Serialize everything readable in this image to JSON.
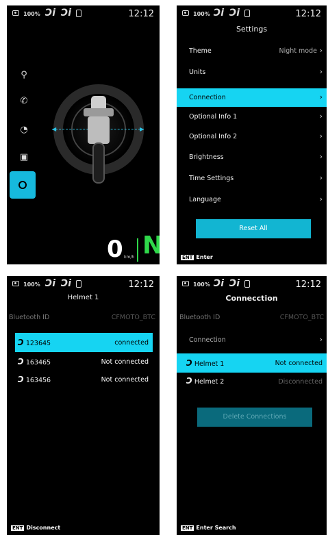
{
  "status": {
    "battery": "100%",
    "time": "12:12",
    "helmet_glyph": "Ɔi"
  },
  "dashboard": {
    "speed": "0",
    "speed_unit": "km/h",
    "gear": "N",
    "side_icons": [
      "motorcycle-icon",
      "phone-icon",
      "gauge-icon",
      "screen-icon",
      "gear-icon"
    ]
  },
  "settings": {
    "title": "Settings",
    "items": [
      {
        "label": "Theme",
        "value": "Night mode"
      },
      {
        "label": "Units",
        "value": ""
      },
      {
        "label": "Connection",
        "value": ""
      },
      {
        "label": "Optional Info 1",
        "value": ""
      },
      {
        "label": "Optional Info 2",
        "value": ""
      },
      {
        "label": "Brightness",
        "value": ""
      },
      {
        "label": "Time Settings",
        "value": ""
      },
      {
        "label": "Language",
        "value": ""
      }
    ],
    "reset_label": "Reset All",
    "footer_key": "ENT",
    "footer_text": "Enter"
  },
  "helmet1": {
    "title": "Helmet 1",
    "bt_label": "Bluetooth ID",
    "bt_value": "CFMOTO_BTC",
    "devices": [
      {
        "id": "123645",
        "status": "connected"
      },
      {
        "id": "163465",
        "status": "Not connected"
      },
      {
        "id": "163456",
        "status": "Not connected"
      }
    ],
    "footer_key": "ENT",
    "footer_text": "Disconnect"
  },
  "connection": {
    "title": "Connecction",
    "bt_label": "Bluetooth ID",
    "bt_value": "CFMOTO_BTC",
    "connection_label": "Connection",
    "helmets": [
      {
        "label": "Helmet 1",
        "status": "Not connected"
      },
      {
        "label": "Helmet 2",
        "status": "Disconnected"
      }
    ],
    "delete_label": "Delete Connections",
    "footer_key": "ENT",
    "footer_text": "Enter Search"
  },
  "colors": {
    "accent": "#16d4f2",
    "gear": "#2fd84a",
    "background": "#000000"
  }
}
